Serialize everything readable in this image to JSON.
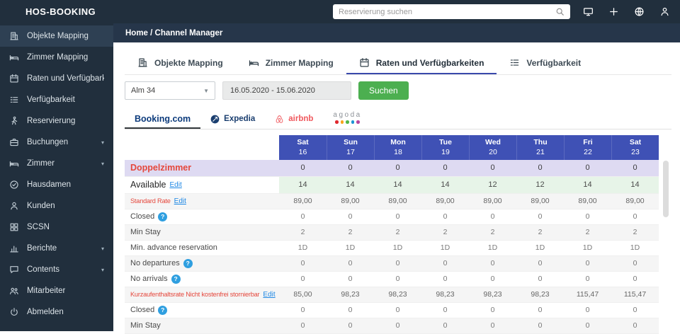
{
  "app": {
    "brand": "HOS-BOOKING"
  },
  "topbar": {
    "search_placeholder": "Reservierung suchen",
    "icons": [
      "screen-share-icon",
      "plus-icon",
      "globe-icon",
      "user-icon"
    ]
  },
  "breadcrumb": {
    "text": "Home / Channel Manager"
  },
  "sidebar": {
    "items": [
      {
        "label": "Objekte Mapping",
        "icon": "building-icon",
        "active": true
      },
      {
        "label": "Zimmer Mapping",
        "icon": "bed-icon"
      },
      {
        "label": "Raten und Verfügbarkeiten",
        "icon": "calendar-icon"
      },
      {
        "label": "Verfügbarkeit",
        "icon": "list-icon"
      },
      {
        "label": "Reservierung",
        "icon": "walking-person-icon"
      },
      {
        "label": "Buchungen",
        "icon": "briefcase-icon",
        "expandable": true
      },
      {
        "label": "Zimmer",
        "icon": "bed-icon",
        "expandable": true
      },
      {
        "label": "Hausdamen",
        "icon": "check-circle-icon"
      },
      {
        "label": "Kunden",
        "icon": "person-icon"
      },
      {
        "label": "SCSN",
        "icon": "grid-icon"
      },
      {
        "label": "Berichte",
        "icon": "chart-icon",
        "expandable": true
      },
      {
        "label": "Contents",
        "icon": "chat-icon",
        "expandable": true
      },
      {
        "label": "Mitarbeiter",
        "icon": "people-icon"
      },
      {
        "label": "Abmelden",
        "icon": "power-icon"
      }
    ]
  },
  "tabs": [
    {
      "label": "Objekte Mapping",
      "icon": "building-icon"
    },
    {
      "label": "Zimmer Mapping",
      "icon": "bed-icon"
    },
    {
      "label": "Raten und Verfügbarkeiten",
      "icon": "calendar-icon",
      "active": true
    },
    {
      "label": "Verfügbarkeit",
      "icon": "list-icon"
    }
  ],
  "filters": {
    "property": "Alm 34",
    "date_range": "16.05.2020 - 15.06.2020",
    "search_button": "Suchen"
  },
  "channels": [
    {
      "name": "Booking.com",
      "active": true
    },
    {
      "name": "Expedia"
    },
    {
      "name": "airbnb"
    },
    {
      "name": "agoda"
    }
  ],
  "table": {
    "columns": [
      {
        "day": "Sat",
        "date": "16"
      },
      {
        "day": "Sun",
        "date": "17"
      },
      {
        "day": "Mon",
        "date": "18"
      },
      {
        "day": "Tue",
        "date": "19"
      },
      {
        "day": "Wed",
        "date": "20"
      },
      {
        "day": "Thu",
        "date": "21"
      },
      {
        "day": "Fri",
        "date": "22"
      },
      {
        "day": "Sat",
        "date": "23"
      }
    ],
    "rows": [
      {
        "label": "Doppelzimmer",
        "variant": "room",
        "values": [
          "0",
          "0",
          "0",
          "0",
          "0",
          "0",
          "0",
          "0"
        ]
      },
      {
        "label": "Available",
        "variant": "available",
        "edit": "Edit",
        "values": [
          "14",
          "14",
          "14",
          "14",
          "12",
          "12",
          "14",
          "14"
        ]
      },
      {
        "label": "Standard Rate",
        "variant": "rate",
        "edit": "Edit",
        "values": [
          "89,00",
          "89,00",
          "89,00",
          "89,00",
          "89,00",
          "89,00",
          "89,00",
          "89,00"
        ]
      },
      {
        "label": "Closed",
        "variant": "plain",
        "help": true,
        "values": [
          "0",
          "0",
          "0",
          "0",
          "0",
          "0",
          "0",
          "0"
        ]
      },
      {
        "label": "Min Stay",
        "variant": "alt",
        "values": [
          "2",
          "2",
          "2",
          "2",
          "2",
          "2",
          "2",
          "2"
        ]
      },
      {
        "label": "Min. advance reservation",
        "variant": "plain",
        "values": [
          "1D",
          "1D",
          "1D",
          "1D",
          "1D",
          "1D",
          "1D",
          "1D"
        ]
      },
      {
        "label": "No departures",
        "variant": "alt",
        "help": true,
        "values": [
          "0",
          "0",
          "0",
          "0",
          "0",
          "0",
          "0",
          "0"
        ]
      },
      {
        "label": "No arrivals",
        "variant": "plain",
        "help": true,
        "values": [
          "0",
          "0",
          "0",
          "0",
          "0",
          "0",
          "0",
          "0"
        ]
      },
      {
        "label": "Kurzaufenthaltsrate Nicht kostenfrei stornierbar",
        "variant": "rate",
        "edit": "Edit",
        "values": [
          "85,00",
          "98,23",
          "98,23",
          "98,23",
          "98,23",
          "98,23",
          "115,47",
          "115,47"
        ]
      },
      {
        "label": "Closed",
        "variant": "plain",
        "help": true,
        "values": [
          "0",
          "0",
          "0",
          "0",
          "0",
          "0",
          "0",
          "0"
        ]
      },
      {
        "label": "Min Stay",
        "variant": "alt",
        "values": [
          "0",
          "0",
          "0",
          "0",
          "0",
          "0",
          "0",
          "0"
        ]
      }
    ]
  },
  "colors": {
    "topbar_bg": "#212f3d",
    "breadcrumb_bg": "#26364a",
    "sidebar_active_bg": "#2e4053",
    "header_indigo": "#3f51b5",
    "suchen_green": "#4caf50",
    "room_row_bg": "#dedaf2",
    "available_row_bg": "#e7f4e8",
    "label_red": "#e5473c",
    "edit_link_blue": "#1e88e5",
    "help_badge_blue": "#2f9fe0",
    "booking_blue": "#0c3b7c",
    "expedia_navy": "#1a3e6f",
    "airbnb_red": "#f0575c",
    "agoda_dots": [
      "#e0282e",
      "#f8a51b",
      "#51b648",
      "#1c95d4",
      "#b7469f"
    ]
  }
}
